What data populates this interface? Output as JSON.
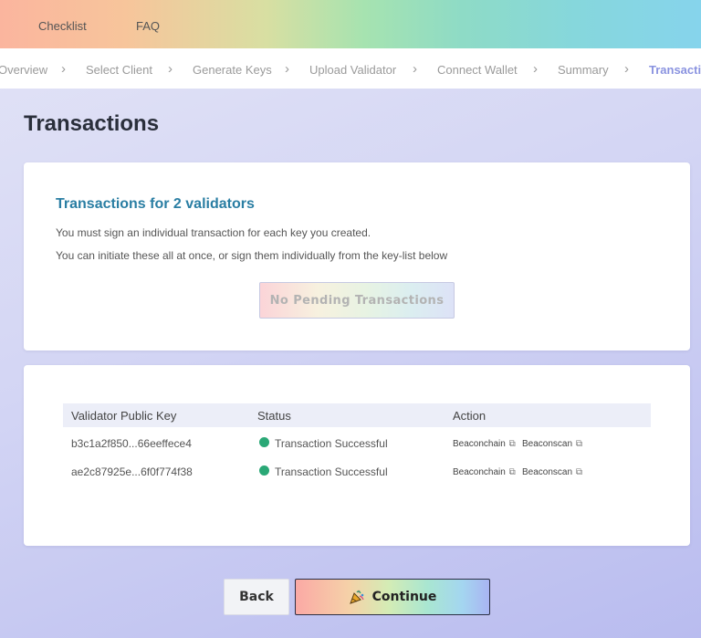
{
  "topnav": {
    "items": [
      {
        "label": "Checklist"
      },
      {
        "label": "FAQ"
      }
    ]
  },
  "steps": [
    {
      "label": "Overview"
    },
    {
      "label": "Select Client"
    },
    {
      "label": "Generate Keys"
    },
    {
      "label": "Upload Validator"
    },
    {
      "label": "Connect Wallet"
    },
    {
      "label": "Summary"
    },
    {
      "label": "Transactions"
    }
  ],
  "page": {
    "title": "Transactions"
  },
  "transactions_card": {
    "heading": "Transactions for 2 validators",
    "line1": "You must sign an individual transaction for each key you created.",
    "line2": "You can initiate these all at once, or sign them individually from the key-list below",
    "button_label": "No Pending Transactions"
  },
  "table": {
    "headers": {
      "key": "Validator Public Key",
      "status": "Status",
      "action": "Action"
    },
    "rows": [
      {
        "key": "b3c1a2f850...66eeffece4",
        "status": "Transaction Successful",
        "link1": "Beaconchain",
        "link2": "Beaconscan"
      },
      {
        "key": "ae2c87925e...6f0f774f38",
        "status": "Transaction Successful",
        "link1": "Beaconchain",
        "link2": "Beaconscan"
      }
    ],
    "status_color": "#2aa876"
  },
  "footer": {
    "back_label": "Back",
    "continue_label": "Continue",
    "continue_icon": "party-popper-icon"
  },
  "colors": {
    "active_step": "#8a93e0",
    "heading_blue": "#2a7ea3"
  },
  "icons": {
    "chevron": "›",
    "external_link": "⧉"
  }
}
